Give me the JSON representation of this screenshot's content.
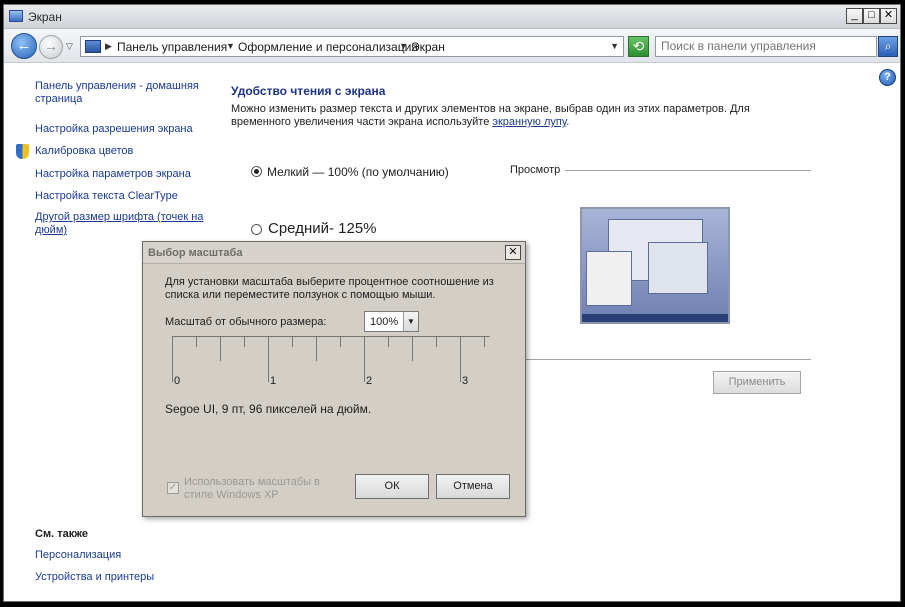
{
  "window": {
    "title": "Экран",
    "controls": {
      "minimize": "_",
      "maximize": "□",
      "close": "✕"
    }
  },
  "address": {
    "crumbs": [
      "Панель управления",
      "Оформление и персонализация",
      "Экран"
    ],
    "search_placeholder": "Поиск в панели управления"
  },
  "sidebar": {
    "home_link": "Панель управления - домашняя страница",
    "links": [
      "Настройка разрешения экрана",
      "Калибровка цветов",
      "Настройка параметров экрана",
      "Настройка текста ClearType",
      "Другой размер шрифта (точек на дюйм)"
    ],
    "see_also_title": "См. также",
    "see_also": [
      "Персонализация",
      "Устройства и принтеры"
    ]
  },
  "main": {
    "heading": "Удобство чтения с экрана",
    "desc_before": "Можно изменить размер текста и других элементов на экране, выбрав один из этих параметров. Для временного увеличения части экрана используйте ",
    "desc_link": "экранную лупу",
    "desc_after": ".",
    "options": [
      {
        "label": "Мелкий — 100% (по умолчанию)",
        "selected": true
      },
      {
        "label": "Средний- 125%",
        "selected": false
      }
    ],
    "preview_label": "Просмотр",
    "apply_button": "Применить"
  },
  "dialog": {
    "title": "Выбор масштаба",
    "close": "✕",
    "instruction": "Для установки масштаба выберите процентное соотношение из списка или переместите ползунок с помощью мыши.",
    "scale_label": "Масштаб от обычного размера:",
    "scale_value": "100%",
    "ruler_labels": [
      "0",
      "1",
      "2",
      "3"
    ],
    "font_info": "Segoe UI, 9 пт, 96 пикселей на дюйм.",
    "xp_checkbox_label": "Использовать масштабы в стиле Windows XP",
    "xp_checked": true,
    "ok_button": "ОК",
    "cancel_button": "Отмена"
  }
}
